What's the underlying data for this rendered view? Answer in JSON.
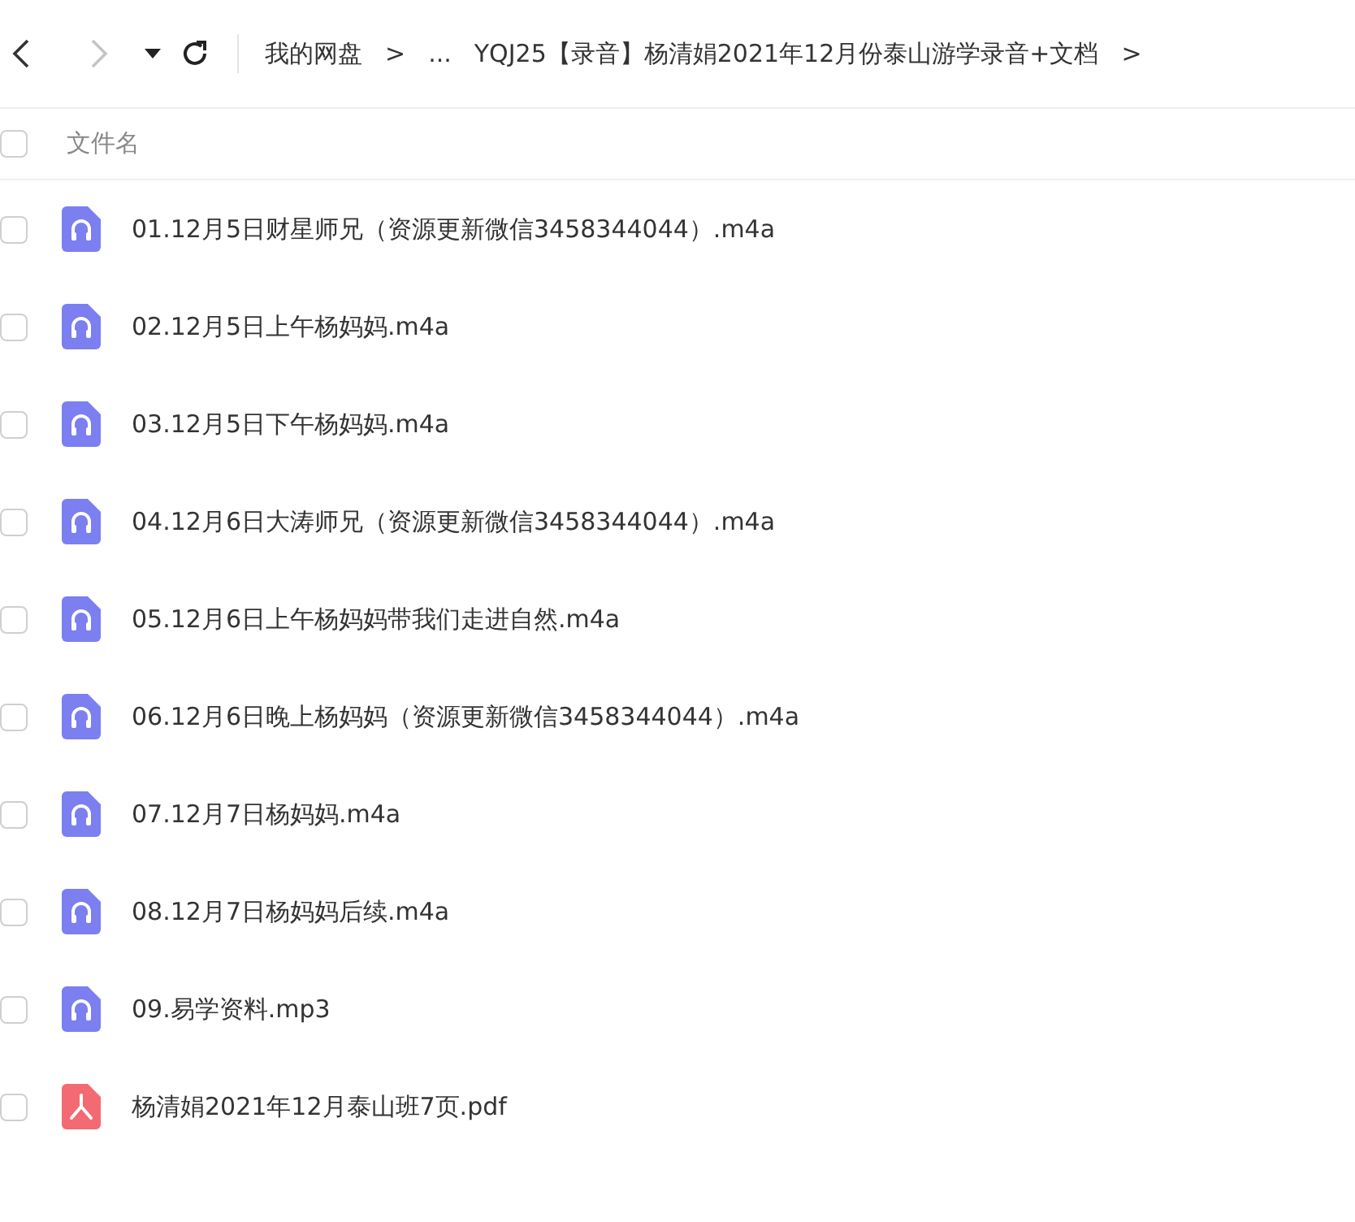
{
  "toolbar": {
    "back_disabled": false,
    "forward_disabled": true
  },
  "breadcrumb": [
    {
      "label": "我的网盘",
      "separator": ">"
    },
    {
      "label": "..."
    },
    {
      "label": "YQJ25【录音】杨清娟2021年12月份泰山游学录音+文档",
      "separator": ">"
    }
  ],
  "header": {
    "checked": false,
    "label": "文件名"
  },
  "files": [
    {
      "name": "01.12月5日财星师兄（资源更新微信3458344044）.m4a",
      "kind": "audio",
      "checked": false
    },
    {
      "name": "02.12月5日上午杨妈妈.m4a",
      "kind": "audio",
      "checked": false
    },
    {
      "name": "03.12月5日下午杨妈妈.m4a",
      "kind": "audio",
      "checked": false
    },
    {
      "name": "04.12月6日大涛师兄（资源更新微信3458344044）.m4a",
      "kind": "audio",
      "checked": false
    },
    {
      "name": "05.12月6日上午杨妈妈带我们走进自然.m4a",
      "kind": "audio",
      "checked": false
    },
    {
      "name": "06.12月6日晚上杨妈妈（资源更新微信3458344044）.m4a",
      "kind": "audio",
      "checked": false
    },
    {
      "name": "07.12月7日杨妈妈.m4a",
      "kind": "audio",
      "checked": false
    },
    {
      "name": "08.12月7日杨妈妈后续.m4a",
      "kind": "audio",
      "checked": false
    },
    {
      "name": "09.易学资料.mp3",
      "kind": "audio",
      "checked": false
    },
    {
      "name": "杨清娟2021年12月泰山班7页.pdf",
      "kind": "pdf",
      "checked": false
    }
  ]
}
